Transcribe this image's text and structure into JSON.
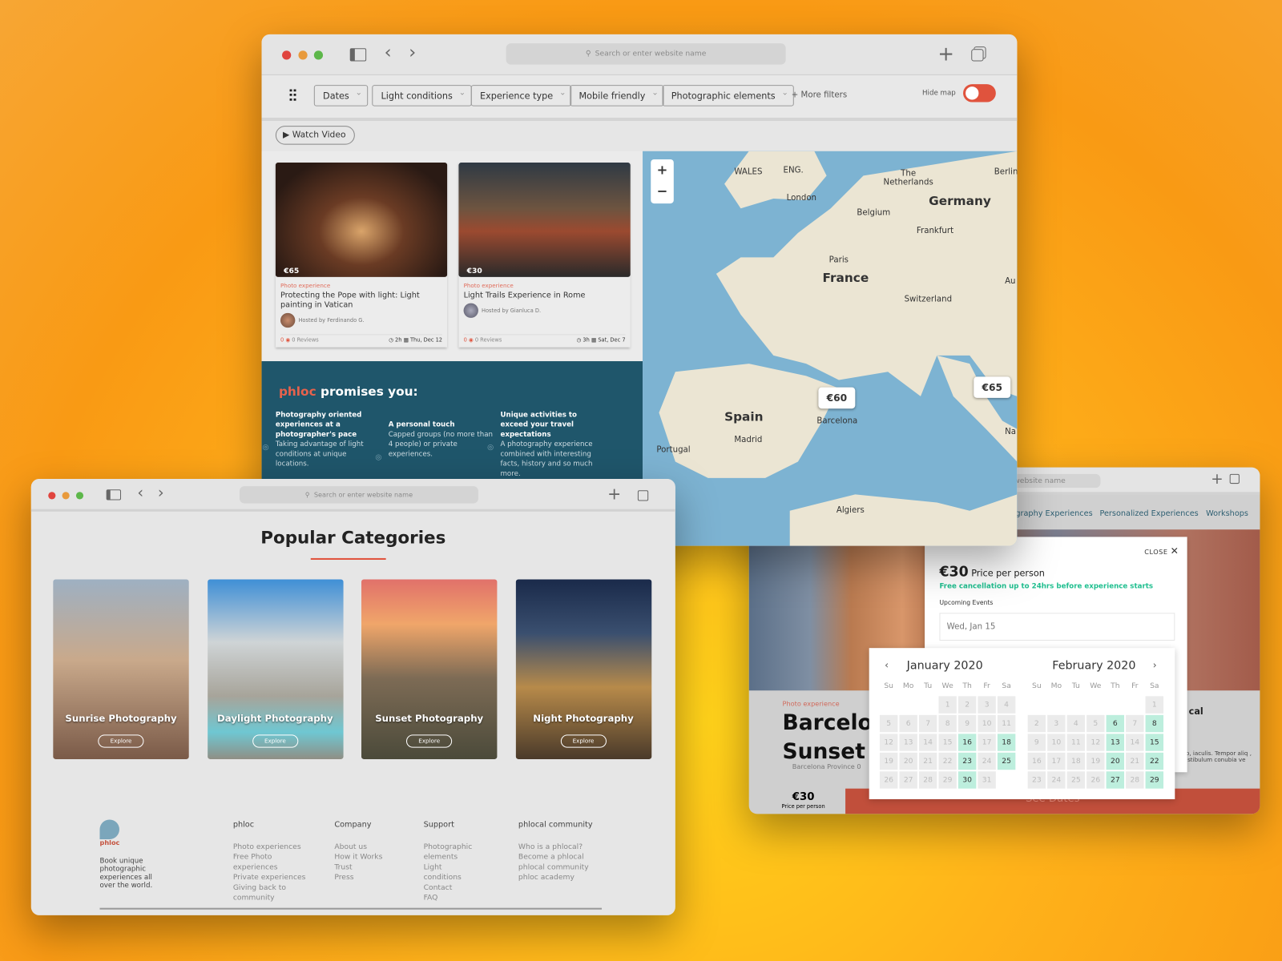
{
  "browser": {
    "search_placeholder": "Search or enter website name"
  },
  "listing": {
    "filters": [
      "Dates",
      "Light conditions",
      "Experience type",
      "Mobile friendly",
      "Photographic elements"
    ],
    "more_filters": "+ More filters",
    "hide_map": "Hide map",
    "hide_map_on": true,
    "watch_video": "Watch Video",
    "cards": [
      {
        "price": "€65",
        "tag": "Photo experience",
        "title": "Protecting the Pope with light: Light painting in Vatican",
        "host": "Hosted by Ferdinando G.",
        "rating": "0",
        "reviews": "0 Reviews",
        "duration": "2h",
        "date": "Thu, Dec 12"
      },
      {
        "price": "€30",
        "tag": "Photo experience",
        "title": "Light Trails Experience in Rome",
        "host": "Hosted by Gianluca D.",
        "rating": "0",
        "reviews": "0 Reviews",
        "duration": "3h",
        "date": "Sat, Dec 7"
      }
    ],
    "promise": {
      "brand": "phloc",
      "title": " promises you:",
      "items": [
        {
          "head": "Photography oriented experiences at a photographer's pace",
          "body": "Taking advantage of light conditions at unique locations."
        },
        {
          "head": "A personal touch",
          "body": "Capped groups (no more than 4 people) or private experiences."
        },
        {
          "head": "Unique activities to exceed your travel expectations",
          "body": "A photography experience combined with interesting facts, history and so much more."
        }
      ]
    },
    "map": {
      "zoom_in": "+",
      "zoom_out": "−",
      "labels": [
        "WALES",
        "ENG.",
        "London",
        "The Netherlands",
        "Berlin",
        "Germany",
        "Belgium",
        "Frankfurt",
        "Paris",
        "France",
        "Switzerland",
        "Au",
        "Spain",
        "Madrid",
        "Portugal",
        "Barcelona",
        "Algiers",
        "Na"
      ],
      "pins": [
        "€60",
        "€65"
      ]
    }
  },
  "categories": {
    "title": "Popular Categories",
    "accent": "#e0533d",
    "items": [
      {
        "name": "Sunrise Photography",
        "button": "Explore"
      },
      {
        "name": "Daylight Photography",
        "button": "Explore"
      },
      {
        "name": "Sunset Photography",
        "button": "Explore"
      },
      {
        "name": "Night Photography",
        "button": "Explore"
      }
    ],
    "footer": {
      "logo": "phloc",
      "tagline": "Book unique photographic experiences all over the world.",
      "columns": [
        {
          "head": "phloc",
          "links": [
            "Photo experiences",
            "Free Photo experiences",
            "Private experiences",
            "Giving back to community"
          ]
        },
        {
          "head": "Company",
          "links": [
            "About us",
            "How it Works",
            "Trust",
            "Press"
          ]
        },
        {
          "head": "Support",
          "links": [
            "Photographic elements",
            "Light conditions",
            "Contact",
            "FAQ"
          ]
        },
        {
          "head": "phlocal community",
          "links": [
            "Who is a phlocal?",
            "Become a phlocal",
            "phlocal community",
            "phloc academy"
          ]
        }
      ]
    }
  },
  "detail": {
    "url_fragment": "website name",
    "nav": [
      "graphy Experiences",
      "Personalized Experiences",
      "Workshops"
    ],
    "tag": "Photo experience",
    "title1": "Barcelo",
    "title2": "Sunset",
    "location": "Barcelona Province 0",
    "side_text": "cal",
    "lorem": "sto, iaculis. Tempor aliq , vestibulum conubia ve",
    "price": "€30",
    "price_label": "Price per person",
    "cta": "See Dates",
    "modal": {
      "close": "CLOSE",
      "price": "€30",
      "price_label": "Price per person",
      "cancel": "Free cancellation up to 24hrs before experience starts",
      "cancel_color": "#1fbf8f",
      "upcoming": "Upcoming Events",
      "input_placeholder": "Wed, Jan 15"
    },
    "calendar": {
      "weekdays": [
        "Su",
        "Mo",
        "Tu",
        "We",
        "Th",
        "Fr",
        "Sa"
      ],
      "months": [
        {
          "name": "January 2020",
          "offset": 3,
          "days": 31,
          "available": [
            16,
            18,
            23,
            25,
            30
          ]
        },
        {
          "name": "February 2020",
          "offset": 6,
          "days": 29,
          "available": [
            6,
            8,
            13,
            15,
            20,
            22,
            27,
            29
          ]
        }
      ]
    }
  }
}
